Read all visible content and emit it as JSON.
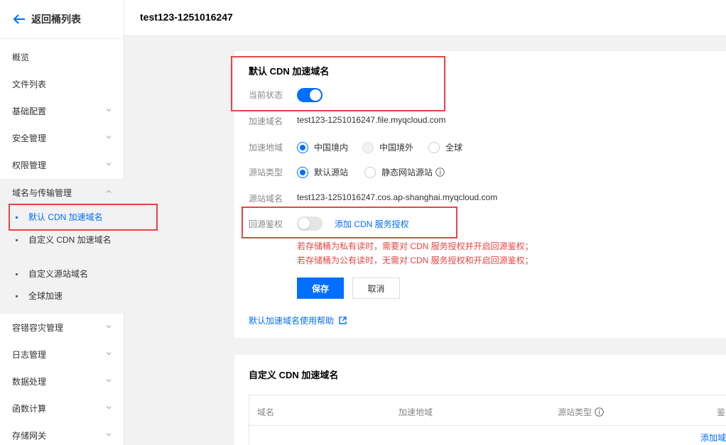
{
  "sidebar": {
    "back_label": "返回桶列表",
    "items": [
      {
        "label": "概览",
        "has_chevron": false
      },
      {
        "label": "文件列表",
        "has_chevron": false
      },
      {
        "label": "基础配置",
        "has_chevron": true
      },
      {
        "label": "安全管理",
        "has_chevron": true
      },
      {
        "label": "权限管理",
        "has_chevron": true
      },
      {
        "label": "域名与传输管理",
        "has_chevron": true,
        "expanded": true
      },
      {
        "label": "容错容灾管理",
        "has_chevron": true
      },
      {
        "label": "日志管理",
        "has_chevron": true
      },
      {
        "label": "数据处理",
        "has_chevron": true
      },
      {
        "label": "函数计算",
        "has_chevron": true
      },
      {
        "label": "存储网关",
        "has_chevron": true
      }
    ],
    "sub_items": [
      {
        "label": "默认 CDN 加速域名",
        "active": true
      },
      {
        "label": "自定义 CDN 加速域名",
        "active": false
      },
      {
        "label": "自定义源站域名",
        "active": false
      },
      {
        "label": "全球加速",
        "active": false
      }
    ]
  },
  "header": {
    "title": "test123-1251016247"
  },
  "default_cdn": {
    "title": "默认 CDN 加速域名",
    "status_label": "当前状态",
    "status_on": true,
    "domain_label": "加速域名",
    "domain_value": "test123-1251016247.file.myqcloud.com",
    "region_label": "加速地域",
    "region_options": [
      "中国境内",
      "中国境外",
      "全球"
    ],
    "origin_type_label": "源站类型",
    "origin_type_options": [
      "默认源站",
      "静态网站源站"
    ],
    "origin_domain_label": "源站域名",
    "origin_domain_value": "test123-1251016247.cos.ap-shanghai.myqcloud.com",
    "auth_label": "回源鉴权",
    "auth_on": false,
    "auth_link": "添加 CDN 服务授权",
    "warn1": "若存储桶为私有读时，需要对 CDN 服务授权并开启回源鉴权；",
    "warn2": "若存储桶为公有读时，无需对 CDN 服务授权和开启回源鉴权；",
    "save_label": "保存",
    "cancel_label": "取消",
    "help_link": "默认加速域名使用帮助"
  },
  "custom_cdn": {
    "title": "自定义 CDN 加速域名",
    "columns": [
      "域名",
      "加速地域",
      "源站类型",
      "鉴"
    ],
    "add_link": "添加域"
  },
  "colors": {
    "accent": "#006eff",
    "warn": "#e54545",
    "highlight_box": "#e54545"
  }
}
